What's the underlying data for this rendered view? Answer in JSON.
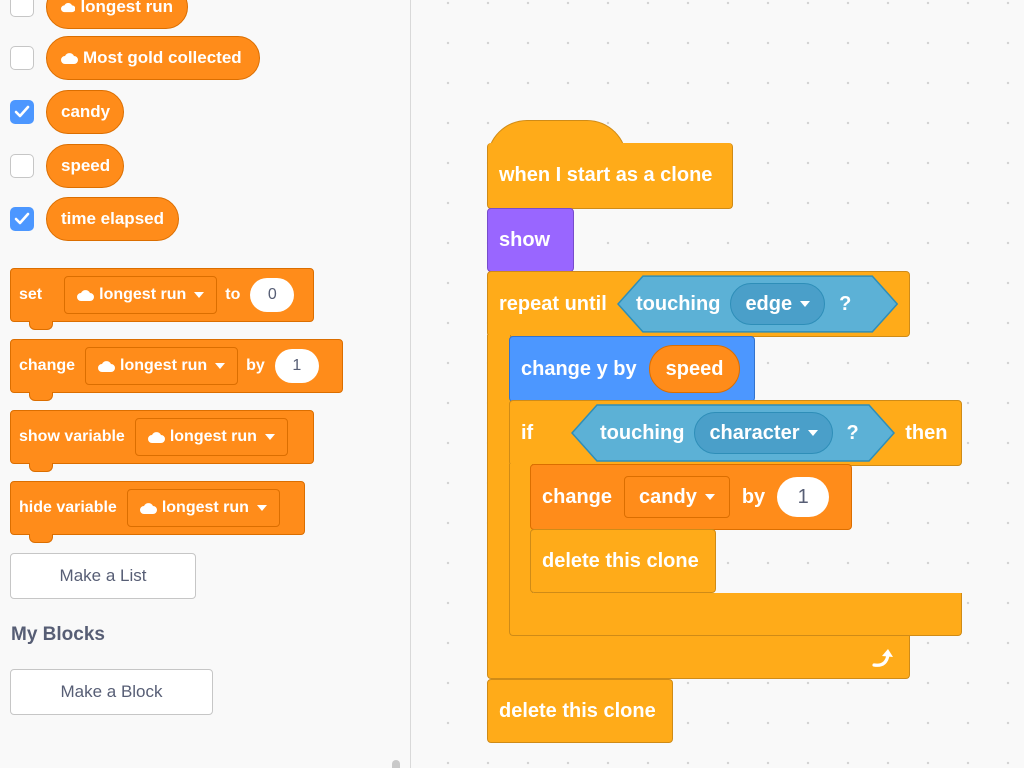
{
  "palette": {
    "variables": [
      {
        "label": "longest run",
        "cloud": true,
        "checked": false
      },
      {
        "label": "Most gold collected",
        "cloud": true,
        "checked": false
      },
      {
        "label": "candy",
        "cloud": false,
        "checked": true
      },
      {
        "label": "speed",
        "cloud": false,
        "checked": false
      },
      {
        "label": "time elapsed",
        "cloud": false,
        "checked": true
      }
    ],
    "set_block": {
      "label": "set",
      "variable": "longest run",
      "to_label": "to",
      "value": "0"
    },
    "change_block": {
      "label": "change",
      "variable": "longest run",
      "by_label": "by",
      "value": "1"
    },
    "show_block": {
      "label": "show variable",
      "variable": "longest run"
    },
    "hide_block": {
      "label": "hide variable",
      "variable": "longest run"
    },
    "make_list": "Make a List",
    "my_blocks_heading": "My Blocks",
    "make_block": "Make a Block"
  },
  "script": {
    "hat": "when I start as a clone",
    "show": "show",
    "repeat_label": "repeat until",
    "repeat_cond": {
      "label": "touching",
      "target": "edge",
      "q": "?"
    },
    "change_y": {
      "label": "change y by",
      "reporter": "speed"
    },
    "if_block": {
      "label": "if",
      "cond_label": "touching",
      "cond_target": "character",
      "q": "?",
      "then": "then"
    },
    "change_var": {
      "label": "change",
      "variable": "candy",
      "by_label": "by",
      "value": "1"
    },
    "delete_inner": "delete this clone",
    "delete_outer": "delete this clone"
  },
  "colors": {
    "control": "#ffab19",
    "looks": "#9966ff",
    "motion": "#4c97ff",
    "sensing": "#5cb1d6",
    "variables": "#ff8c1a",
    "checkbox": "#4c97ff"
  },
  "icons": {
    "cloud": "cloud-icon",
    "check": "check-icon",
    "caret": "chevron-down-icon",
    "loop": "loop-arrow-icon"
  }
}
